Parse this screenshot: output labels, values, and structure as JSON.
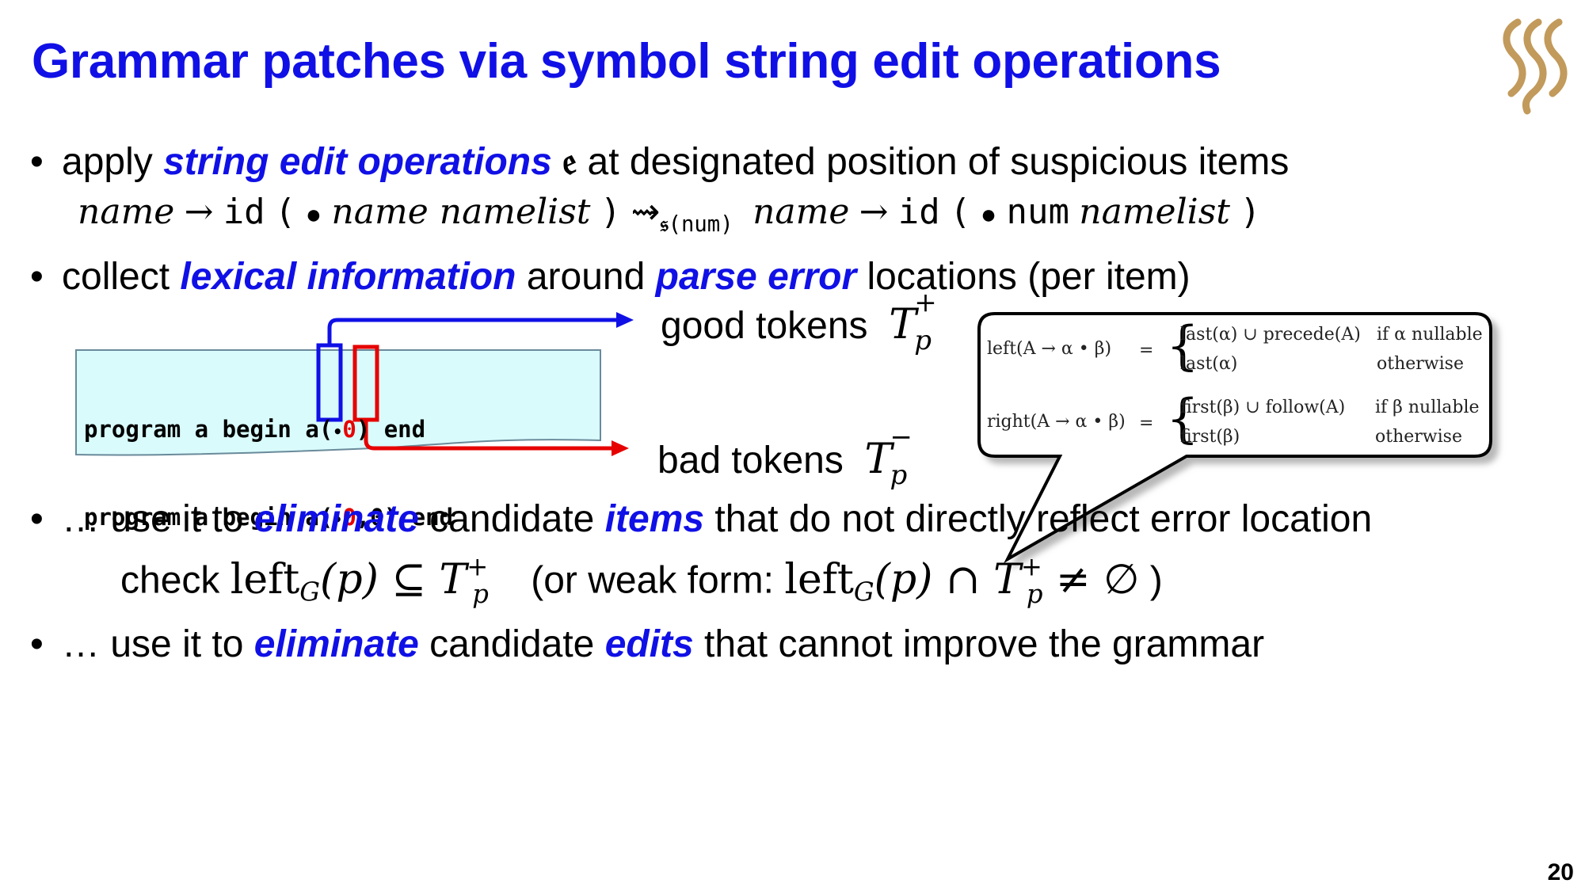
{
  "title": "Grammar patches via symbol string edit operations",
  "page_number": "20",
  "colors": {
    "accent": "#1010e6",
    "bad": "#e60000",
    "code_bg": "#d9fbfc",
    "logo": "#c29a5b"
  },
  "logo_icon": "university-logo",
  "bullet1": {
    "pre": "apply ",
    "kw": "string edit operations",
    "sym": "𝔢",
    "post": " at designated position of suspicious items"
  },
  "rule": {
    "lhs": "name",
    "arrow": "→",
    "id": "id",
    "open": "(",
    "dot": "●",
    "rhs_left": "name namelist",
    "close": ")",
    "squig": "⇝",
    "op": "𝔰",
    "op_arg": "(num)",
    "lhs2": "name",
    "rhs_num": "num",
    "rhs_right": "namelist"
  },
  "bullet2": {
    "pre": "collect ",
    "kw1": "lexical information",
    "mid": " around ",
    "kw2": "parse error",
    "post": " locations (per item)"
  },
  "code": {
    "line1_a": "program a begin a",
    "line1_b": "(",
    "line1_dot": "•",
    "line1_c": "0",
    "line1_d": ") end",
    "line2_a": "program a begin a",
    "line2_b": "(",
    "line2_dot": "•",
    "line2_c": "0",
    "line2_d": ",0) end"
  },
  "good_tokens": {
    "label": "good tokens",
    "T": "T",
    "sup": "+",
    "sub": "p"
  },
  "bad_tokens": {
    "label": "bad tokens",
    "T": "T",
    "sup": "−",
    "sub": "p"
  },
  "callout": {
    "left_lhs": "left(A → α • β)",
    "eq": "=",
    "left_case1": "last(α) ∪ precede(A)",
    "left_cond1": "if α nullable",
    "left_case2": "last(α)",
    "left_cond2": "otherwise",
    "right_lhs": "right(A → α • β)",
    "right_case1": "first(β) ∪ follow(A)",
    "right_cond1": "if β nullable",
    "right_case2": "first(β)",
    "right_cond2": "otherwise"
  },
  "bullet3": {
    "pre": "… use it to ",
    "kw1": "eliminate",
    "mid1": " candidate ",
    "kw2": "items",
    "post": " that do not directly reflect error location"
  },
  "check": {
    "label": "check ",
    "formula": "left",
    "sub_g": "G",
    "arg": "(p)",
    "subseteq": " ⊆ ",
    "T": "T",
    "weak_label": "(or weak form:",
    "cap": " ∩ ",
    "neq": " ≠ ∅",
    "close": " )"
  },
  "bullet4": {
    "pre": "… use it to ",
    "kw1": "eliminate",
    "mid1": " candidate ",
    "kw2": "edits",
    "post": " that cannot improve the grammar"
  }
}
